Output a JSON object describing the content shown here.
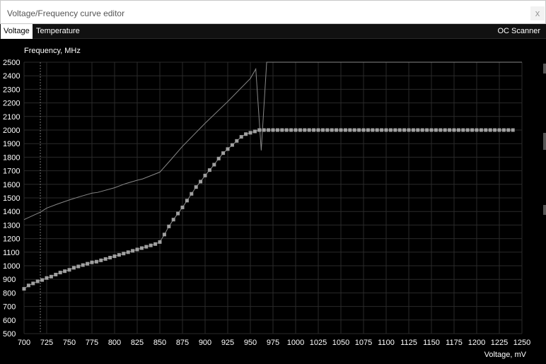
{
  "window": {
    "title": "Voltage/Frequency curve editor",
    "close_glyph": "x"
  },
  "tabs": [
    {
      "label": "Voltage",
      "active": true
    },
    {
      "label": "Temperature",
      "active": false
    }
  ],
  "oc_scanner_label": "OC Scanner",
  "colors": {
    "background": "#000000",
    "grid": "#2a2a2a",
    "curve": "#888888",
    "point": "#a0a0a0",
    "reference_line": "#777777"
  },
  "chart_data": {
    "type": "line",
    "ylabel": "Frequency, MHz",
    "xlabel": "Voltage, mV",
    "xlim": [
      700,
      1250
    ],
    "ylim": [
      500,
      2500
    ],
    "x_ticks": [
      700,
      725,
      750,
      775,
      800,
      825,
      850,
      875,
      900,
      925,
      950,
      975,
      1000,
      1025,
      1050,
      1075,
      1100,
      1125,
      1150,
      1175,
      1200,
      1225,
      1250
    ],
    "y_ticks": [
      500,
      600,
      700,
      800,
      900,
      1000,
      1100,
      1200,
      1300,
      1400,
      1500,
      1600,
      1700,
      1800,
      1900,
      2000,
      2100,
      2200,
      2300,
      2400,
      2500
    ],
    "grid": true,
    "marker_voltage": 718,
    "series": [
      {
        "style": "thin-line",
        "x": [
          700,
          718,
          725,
          737,
          750,
          762,
          775,
          781,
          800,
          812,
          825,
          831,
          850,
          862,
          875,
          900,
          925,
          950,
          956,
          962,
          968,
          970,
          1250
        ],
        "y": [
          1340,
          1395,
          1425,
          1455,
          1485,
          1510,
          1535,
          1540,
          1575,
          1605,
          1630,
          1640,
          1690,
          1780,
          1880,
          2050,
          2210,
          2380,
          2450,
          1850,
          2500,
          2500,
          2500
        ]
      },
      {
        "style": "points",
        "x": [
          700,
          705,
          710,
          715,
          720,
          725,
          730,
          735,
          740,
          745,
          750,
          755,
          760,
          765,
          770,
          775,
          780,
          785,
          790,
          795,
          800,
          805,
          810,
          815,
          820,
          825,
          830,
          835,
          840,
          845,
          850,
          855,
          860,
          865,
          870,
          875,
          880,
          885,
          890,
          895,
          900,
          905,
          910,
          915,
          920,
          925,
          930,
          935,
          940,
          945,
          950,
          955,
          960
        ],
        "y": [
          830,
          855,
          870,
          885,
          895,
          910,
          920,
          935,
          950,
          960,
          970,
          985,
          995,
          1005,
          1015,
          1025,
          1030,
          1040,
          1050,
          1060,
          1070,
          1080,
          1090,
          1100,
          1110,
          1120,
          1130,
          1140,
          1150,
          1160,
          1175,
          1230,
          1290,
          1340,
          1385,
          1430,
          1480,
          1530,
          1580,
          1620,
          1665,
          1705,
          1745,
          1790,
          1830,
          1860,
          1890,
          1920,
          1950,
          1970,
          1980,
          1990,
          2000
        ]
      },
      {
        "style": "points",
        "x": [
          960,
          965,
          970,
          975,
          980,
          985,
          990,
          995,
          1000,
          1005,
          1010,
          1015,
          1020,
          1025,
          1030,
          1035,
          1040,
          1045,
          1050,
          1055,
          1060,
          1065,
          1070,
          1075,
          1080,
          1085,
          1090,
          1095,
          1100,
          1105,
          1110,
          1115,
          1120,
          1125,
          1130,
          1135,
          1140,
          1145,
          1150,
          1155,
          1160,
          1165,
          1170,
          1175,
          1180,
          1185,
          1190,
          1195,
          1200,
          1205,
          1210,
          1215,
          1220,
          1225,
          1230,
          1235,
          1240
        ],
        "y": [
          2000,
          2000,
          2000,
          2000,
          2000,
          2000,
          2000,
          2000,
          2000,
          2000,
          2000,
          2000,
          2000,
          2000,
          2000,
          2000,
          2000,
          2000,
          2000,
          2000,
          2000,
          2000,
          2000,
          2000,
          2000,
          2000,
          2000,
          2000,
          2000,
          2000,
          2000,
          2000,
          2000,
          2000,
          2000,
          2000,
          2000,
          2000,
          2000,
          2000,
          2000,
          2000,
          2000,
          2000,
          2000,
          2000,
          2000,
          2000,
          2000,
          2000,
          2000,
          2000,
          2000,
          2000,
          2000,
          2000,
          2000
        ]
      }
    ]
  }
}
